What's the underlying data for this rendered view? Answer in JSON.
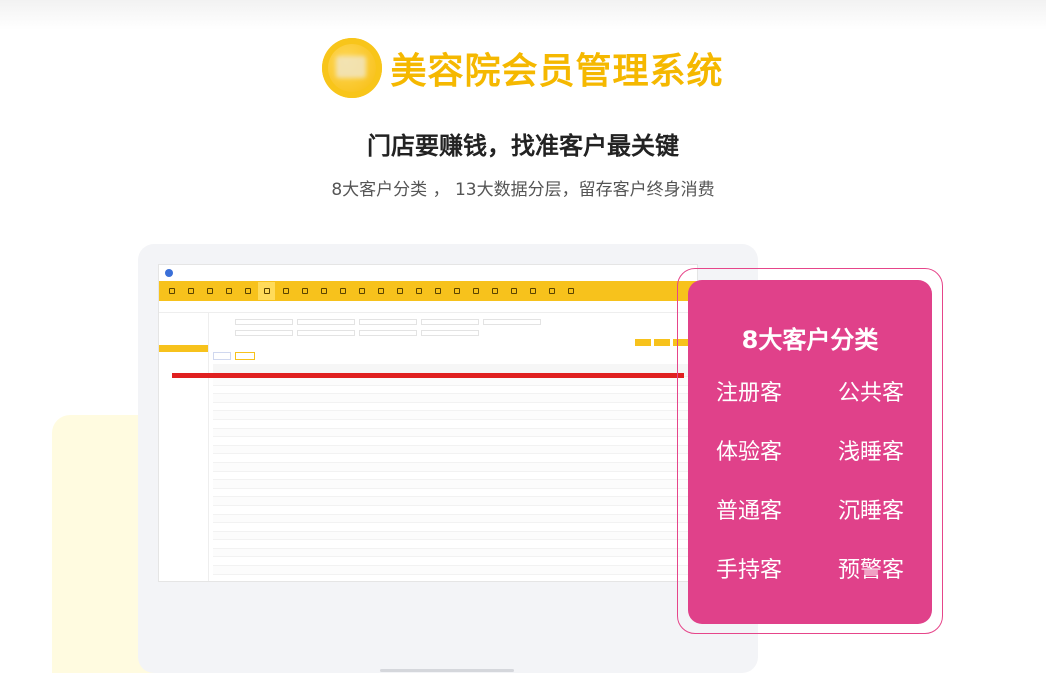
{
  "header": {
    "brand_title": "美容院会员管理系统",
    "headline": "门店要赚钱，找准客户最关键",
    "subline": "8大客户分类 ， 13大数据分层，留存客户终身消费"
  },
  "callout": {
    "title": "8大客户分类",
    "categories": [
      "注册客",
      "公共客",
      "体验客",
      "浅睡客",
      "普通客",
      "沉睡客",
      "手持客",
      "预警客"
    ]
  },
  "colors": {
    "brand_yellow": "#f5b800",
    "callout_pink": "#e0418a",
    "highlight_red": "#e02020"
  }
}
